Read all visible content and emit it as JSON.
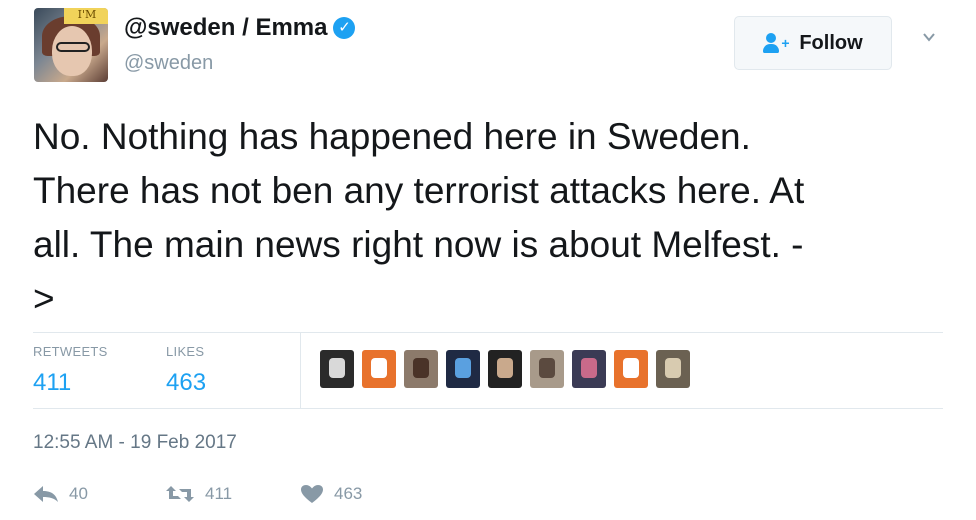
{
  "author": {
    "avatar_badge": "I'M",
    "display_name": "@sweden / Emma",
    "handle": "@sweden",
    "verified": true
  },
  "follow_button": {
    "label": "Follow"
  },
  "tweet": {
    "text": "No. Nothing has happened here in Sweden.\nThere has not ben any terrorist attacks here. At\nall. The main news right now is about Melfest. -\n>"
  },
  "stats": {
    "retweets_label": "RETWEETS",
    "retweets_value": "411",
    "likes_label": "LIKES",
    "likes_value": "463"
  },
  "likers": [
    {
      "icon": "liker-avatar-1",
      "bg": "#2b2b2b",
      "fg": "#d9d9d9"
    },
    {
      "icon": "liker-avatar-2",
      "bg": "#e8722c",
      "fg": "#ffffff"
    },
    {
      "icon": "liker-avatar-3",
      "bg": "#8c7a6b",
      "fg": "#4a3328"
    },
    {
      "icon": "liker-avatar-4",
      "bg": "#1f2a44",
      "fg": "#5aa0e0"
    },
    {
      "icon": "liker-avatar-5",
      "bg": "#222222",
      "fg": "#c9a98c"
    },
    {
      "icon": "liker-avatar-6",
      "bg": "#a89a8a",
      "fg": "#5b4a3f"
    },
    {
      "icon": "liker-avatar-7",
      "bg": "#3b3b55",
      "fg": "#c96a8a"
    },
    {
      "icon": "liker-avatar-8",
      "bg": "#e8722c",
      "fg": "#ffffff"
    },
    {
      "icon": "liker-avatar-9",
      "bg": "#6b6152",
      "fg": "#d8cbb0"
    }
  ],
  "timestamp": "12:55 AM - 19 Feb 2017",
  "actions": {
    "reply_count": "40",
    "retweet_count": "411",
    "like_count": "463"
  },
  "colors": {
    "accent": "#1da1f2",
    "muted": "#8899a6",
    "text": "#14171a",
    "border": "#e1e8ed"
  }
}
